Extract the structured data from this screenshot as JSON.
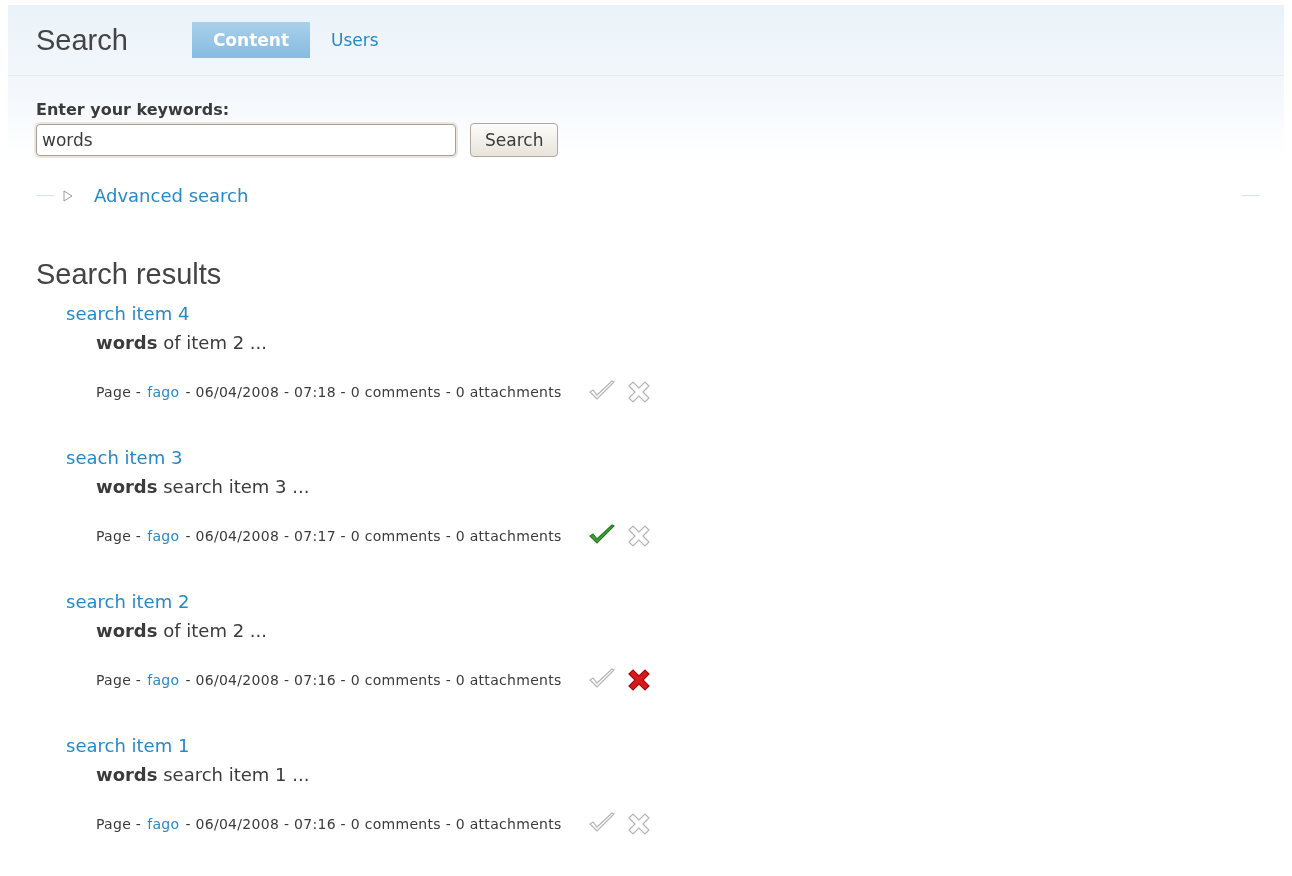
{
  "header": {
    "title": "Search",
    "tabs": [
      {
        "label": "Content",
        "selected": true
      },
      {
        "label": "Users",
        "selected": false
      }
    ]
  },
  "search_form": {
    "label": "Enter your keywords:",
    "value": "words",
    "button": "Search"
  },
  "advanced_search": {
    "label": "Advanced search",
    "expanded": false
  },
  "results": {
    "heading": "Search results",
    "items": [
      {
        "title": "search item 4",
        "snippet": "**words** of item 2 ...",
        "meta_before": "Page -",
        "author": "fago",
        "meta_after": "- 06/04/2008 - 07:18 - 0 comments - 0 attachments",
        "approved": false,
        "rejected": false
      },
      {
        "title": "seach item 3",
        "snippet": "**words** search item 3 ...",
        "meta_before": "Page -",
        "author": "fago",
        "meta_after": "- 06/04/2008 - 07:17 - 0 comments - 0 attachments",
        "approved": true,
        "rejected": false
      },
      {
        "title": "search item 2",
        "snippet": "**words** of item 2 ...",
        "meta_before": "Page -",
        "author": "fago",
        "meta_after": "- 06/04/2008 - 07:16 - 0 comments - 0 attachments",
        "approved": false,
        "rejected": true
      },
      {
        "title": "search item 1",
        "snippet": "**words** search item 1 ...",
        "meta_before": "Page -",
        "author": "fago",
        "meta_after": "- 06/04/2008 - 07:16 - 0 comments - 0 attachments",
        "approved": false,
        "rejected": false
      }
    ]
  }
}
